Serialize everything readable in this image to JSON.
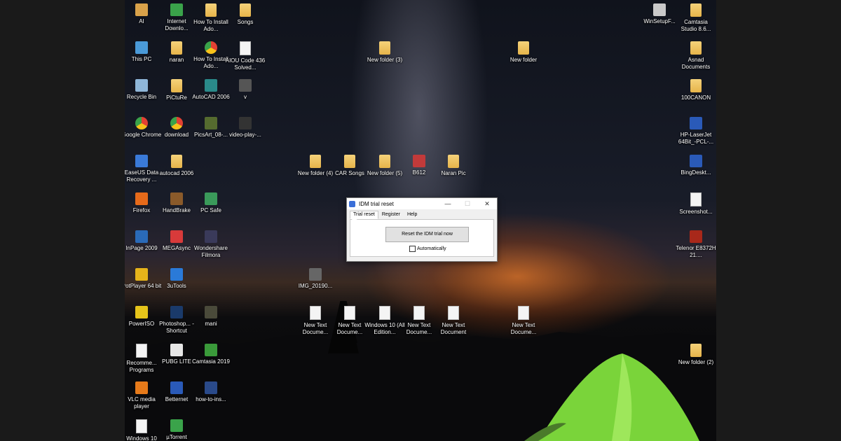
{
  "desktop": {
    "icons": [
      {
        "label": "AI",
        "kind": "app",
        "color": "#d9a24a"
      },
      {
        "label": "Internet Downlo...",
        "kind": "app",
        "color": "#3aa34a"
      },
      {
        "label": "How To Install Ado...",
        "kind": "folder",
        "color": "#e6b44a"
      },
      {
        "label": "Songs",
        "kind": "folder",
        "color": "#e6b44a"
      },
      {
        "label": "WinSetupF...",
        "kind": "app",
        "color": "#c9c9c9"
      },
      {
        "label": "Camtasia Studio 8.6...",
        "kind": "folder",
        "color": "#e6b44a"
      },
      {
        "label": "This PC",
        "kind": "app",
        "color": "#4a9ad8"
      },
      {
        "label": "naran",
        "kind": "folder",
        "color": "#e6b44a"
      },
      {
        "label": "How To Install Ado...",
        "kind": "chrome",
        "color": "#e34133"
      },
      {
        "label": "AIOU Code 436 Solved...",
        "kind": "doc",
        "color": "#ffffff"
      },
      {
        "label": "New folder (3)",
        "kind": "folder",
        "color": "#e6b44a"
      },
      {
        "label": "New folder",
        "kind": "folder",
        "color": "#e6b44a"
      },
      {
        "label": "Asnad Documents",
        "kind": "folder",
        "color": "#e6b44a"
      },
      {
        "label": "Recycle Bin",
        "kind": "app",
        "color": "#8fb6d8"
      },
      {
        "label": "PiCtuRe",
        "kind": "folder",
        "color": "#e6b44a"
      },
      {
        "label": "AutoCAD 2006",
        "kind": "app",
        "color": "#2a8a8a"
      },
      {
        "label": "v",
        "kind": "app",
        "color": "#555555"
      },
      {
        "label": "100CANON",
        "kind": "folder",
        "color": "#e6b44a"
      },
      {
        "label": "Google Chrome",
        "kind": "chrome",
        "color": "#e34133"
      },
      {
        "label": "download",
        "kind": "chrome",
        "color": "#e34133"
      },
      {
        "label": "PicsArt_08-...",
        "kind": "app",
        "color": "#556b2f"
      },
      {
        "label": "video-play-...",
        "kind": "app",
        "color": "#333333"
      },
      {
        "label": "HP-LaserJet 64Bit_-PCL-...",
        "kind": "app",
        "color": "#2a5ab8"
      },
      {
        "label": "EaseUS Data Recovery ...",
        "kind": "app",
        "color": "#3a7ad8"
      },
      {
        "label": "autocad 2006",
        "kind": "folder",
        "color": "#e6b44a"
      },
      {
        "label": "New folder (4)",
        "kind": "folder",
        "color": "#e6b44a"
      },
      {
        "label": "CAR Songs",
        "kind": "folder",
        "color": "#e6b44a"
      },
      {
        "label": "New folder (5)",
        "kind": "folder",
        "color": "#e6b44a"
      },
      {
        "label": "B612",
        "kind": "app",
        "color": "#c23a3a"
      },
      {
        "label": "Naran Pic",
        "kind": "folder",
        "color": "#e6b44a"
      },
      {
        "label": "BingDeskt...",
        "kind": "app",
        "color": "#2a5ab8"
      },
      {
        "label": "Firefox",
        "kind": "app",
        "color": "#e66a1a"
      },
      {
        "label": "HandBrake",
        "kind": "app",
        "color": "#8a5a2a"
      },
      {
        "label": "PC Safe",
        "kind": "app",
        "color": "#3a9a5a"
      },
      {
        "label": "Screenshot...",
        "kind": "doc",
        "color": "#ffffff"
      },
      {
        "label": "InPage 2009",
        "kind": "app",
        "color": "#2a6ab8"
      },
      {
        "label": "MEGAsync",
        "kind": "app",
        "color": "#d83a3a"
      },
      {
        "label": "Wondershare Filmora",
        "kind": "app",
        "color": "#3a3a5a"
      },
      {
        "label": "Telenor E8372H 21....",
        "kind": "app",
        "color": "#a8281a"
      },
      {
        "label": "IMG_20190...",
        "kind": "app",
        "color": "#666666"
      },
      {
        "label": "PotPlayer 64 bit",
        "kind": "app",
        "color": "#e6b41a"
      },
      {
        "label": "3uTools",
        "kind": "app",
        "color": "#2a7ad8"
      },
      {
        "label": "PowerISO",
        "kind": "app",
        "color": "#e6c41a"
      },
      {
        "label": "Photoshop... - Shortcut",
        "kind": "app",
        "color": "#1a3a6a"
      },
      {
        "label": "mani",
        "kind": "app",
        "color": "#4a4a3a"
      },
      {
        "label": "New Text Docume...",
        "kind": "doc",
        "color": "#ffffff"
      },
      {
        "label": "New Text Docume...",
        "kind": "doc",
        "color": "#ffffff"
      },
      {
        "label": "Windows 10 (All Edition...",
        "kind": "doc",
        "color": "#ffffff"
      },
      {
        "label": "New Text Docume...",
        "kind": "doc",
        "color": "#ffffff"
      },
      {
        "label": "New Text Document",
        "kind": "doc",
        "color": "#ffffff"
      },
      {
        "label": "New Text Docume...",
        "kind": "doc",
        "color": "#ffffff"
      },
      {
        "label": "Recomme... Programs",
        "kind": "doc",
        "color": "#ffffff"
      },
      {
        "label": "PUBG LITE",
        "kind": "app",
        "color": "#e6e6e6"
      },
      {
        "label": "Camtasia 2019",
        "kind": "app",
        "color": "#3a9a3a"
      },
      {
        "label": "New folder (2)",
        "kind": "folder",
        "color": "#e6b44a"
      },
      {
        "label": "VLC media player",
        "kind": "app",
        "color": "#e67a1a"
      },
      {
        "label": "Betternet",
        "kind": "app",
        "color": "#2a5ab8"
      },
      {
        "label": "how-to-ins...",
        "kind": "app",
        "color": "#2a4a8a"
      },
      {
        "label": "Windows 10",
        "kind": "doc",
        "color": "#ffffff"
      },
      {
        "label": "µTorrent",
        "kind": "app",
        "color": "#3aa34a"
      }
    ]
  },
  "dialog": {
    "title": "IDM trial reset",
    "minimize": "—",
    "maximize": "☐",
    "close": "✕",
    "tabs": [
      "Trial reset",
      "Register",
      "Help"
    ],
    "active_tab": "Trial reset",
    "reset_button": "Reset the IDM trial now",
    "automatically_label": "Automatically",
    "automatically_checked": false
  }
}
